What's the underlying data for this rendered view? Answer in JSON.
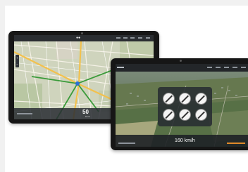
{
  "back_tablet": {
    "brand": "",
    "speed": "50",
    "unit": "km/h",
    "zoom": [
      "+",
      "−"
    ]
  },
  "front_tablet": {
    "speed_readout": "160 km/h",
    "signs": [
      "",
      "",
      "",
      "",
      "",
      ""
    ]
  }
}
